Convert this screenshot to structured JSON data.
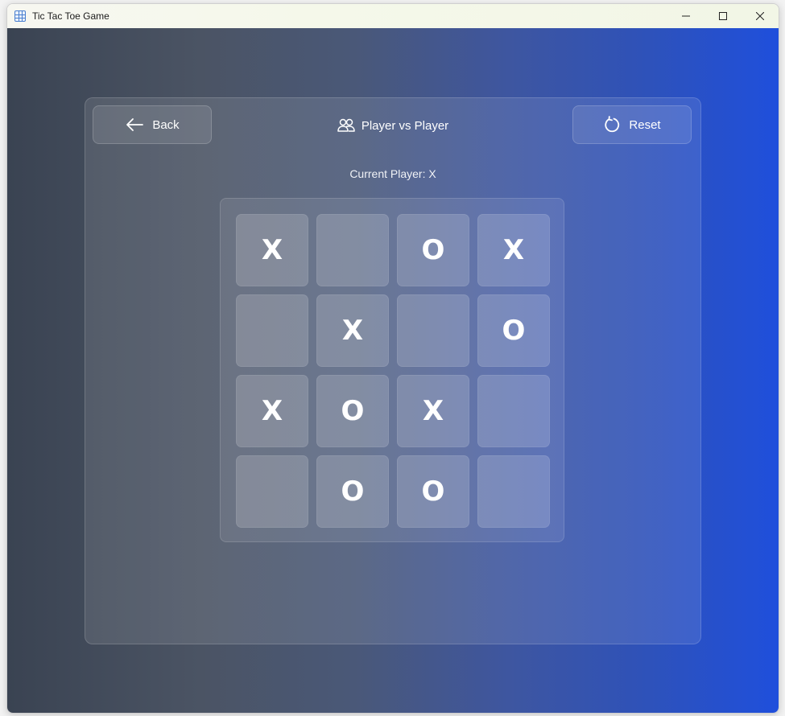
{
  "window": {
    "title": "Tic Tac Toe Game"
  },
  "header": {
    "back_label": "Back",
    "mode_label": "Player vs Player",
    "reset_label": "Reset"
  },
  "status": {
    "current_player_text": "Current Player: X"
  },
  "board": {
    "rows": [
      [
        "X",
        "",
        "O",
        "X"
      ],
      [
        "",
        "X",
        "",
        "O"
      ],
      [
        "X",
        "O",
        "X",
        ""
      ],
      [
        "",
        "O",
        "O",
        ""
      ]
    ]
  },
  "colors": {
    "background_start": "#3a4352",
    "background_end": "#1f4fdc",
    "mark": "#ffffff"
  },
  "icons": {
    "back": "arrow-left-icon",
    "mode": "users-icon",
    "reset": "refresh-icon"
  }
}
